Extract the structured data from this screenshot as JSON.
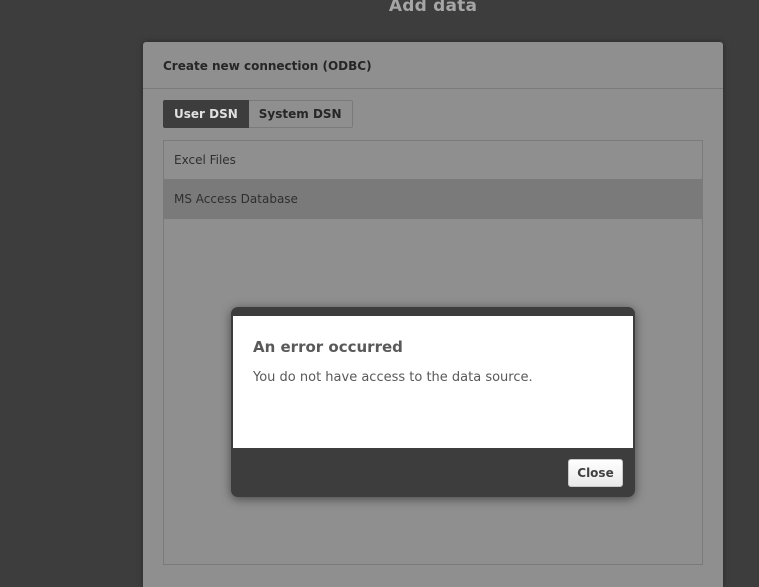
{
  "page": {
    "heading": "Add data"
  },
  "panel": {
    "title": "Create new connection (ODBC)",
    "tabs": [
      {
        "label": "User DSN",
        "active": true
      },
      {
        "label": "System DSN",
        "active": false
      }
    ],
    "dsn_items": [
      {
        "label": "Excel Files",
        "selected": false
      },
      {
        "label": "MS Access Database",
        "selected": true
      }
    ]
  },
  "error_dialog": {
    "title": "An error occurred",
    "message": "You do not have access to the data source.",
    "close_label": "Close"
  },
  "colors": {
    "backdrop": "#3d3d3d",
    "panel": "#8f8f8f",
    "selected_row": "#7a7a7a",
    "dialog_body": "#ffffff"
  }
}
